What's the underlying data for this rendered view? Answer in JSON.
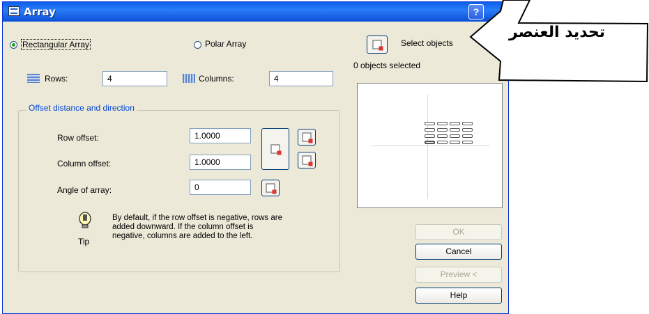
{
  "window": {
    "title": "Array",
    "help_label": "?"
  },
  "mode": {
    "rectangular_label": "Rectangular Array",
    "polar_label": "Polar Array",
    "selected": "rectangular"
  },
  "select_objects": {
    "label": "Select objects",
    "status": "0 objects selected"
  },
  "rows": {
    "label": "Rows:",
    "value": "4"
  },
  "columns": {
    "label": "Columns:",
    "value": "4"
  },
  "offset_group": {
    "title": "Offset distance and direction",
    "row_offset_label": "Row offset:",
    "row_offset_value": "1.0000",
    "column_offset_label": "Column offset:",
    "column_offset_value": "1.0000",
    "angle_label": "Angle of array:",
    "angle_value": "0"
  },
  "tip": {
    "label": "Tip",
    "text": "By default, if the row offset is negative, rows are added downward. If the column offset is negative, columns are added to the left."
  },
  "buttons": {
    "ok": "OK",
    "cancel": "Cancel",
    "preview": "Preview <",
    "help": "Help"
  },
  "annotation": {
    "text": "تحديد العنصر"
  },
  "colors": {
    "title_bar": "#0a5fe8",
    "dialog_bg": "#ece9d8",
    "group_caption": "#0046d5",
    "radio_dot": "#21a121"
  }
}
